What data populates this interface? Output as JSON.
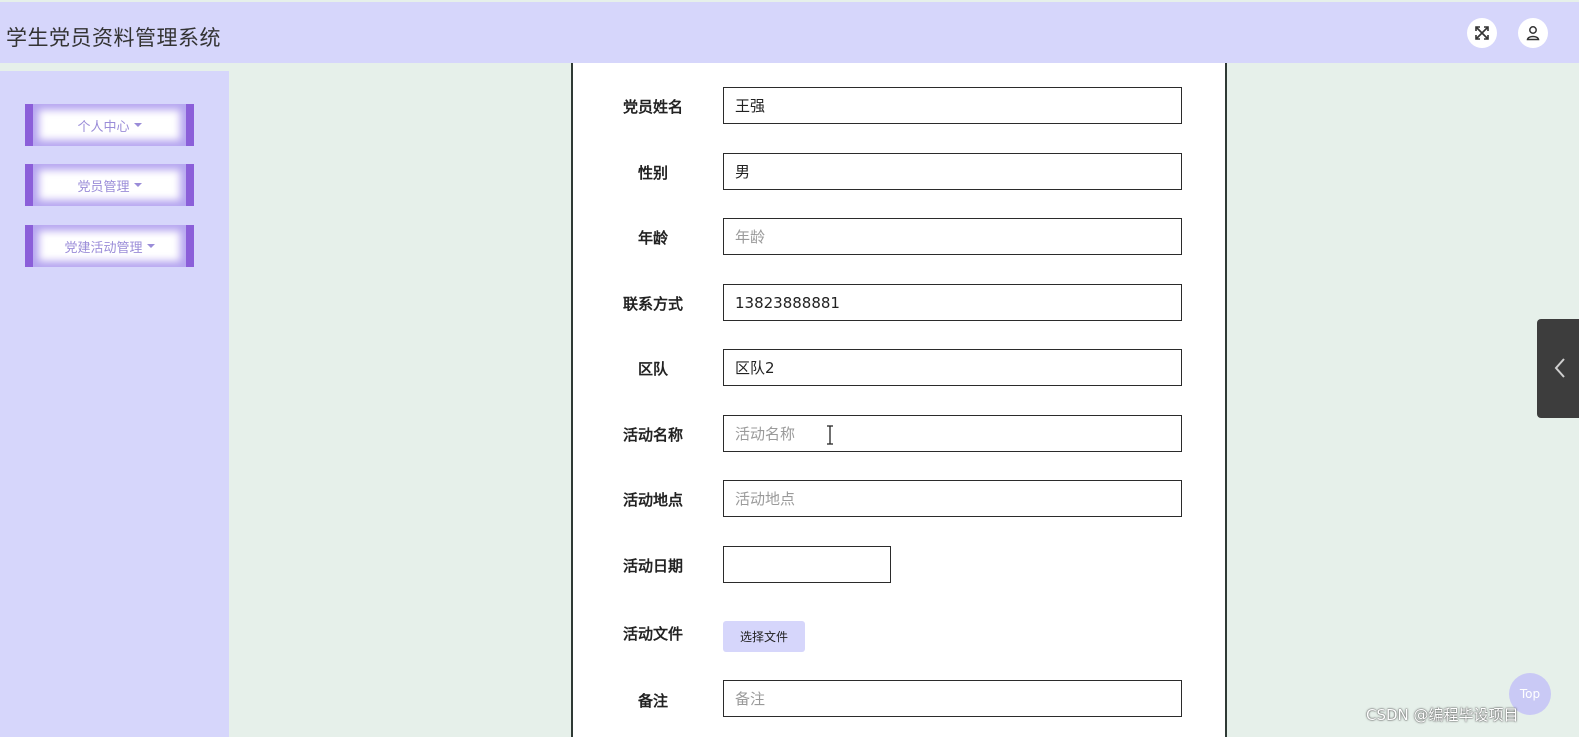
{
  "header": {
    "title": "学生党员资料管理系统",
    "fullscreen_icon": "fullscreen-icon",
    "user_icon": "user-icon"
  },
  "sidebar": {
    "items": [
      {
        "label": "个人中心"
      },
      {
        "label": "党员管理"
      },
      {
        "label": "党建活动管理"
      }
    ]
  },
  "form": {
    "party_member_name": {
      "label": "党员姓名",
      "value": "王强"
    },
    "gender": {
      "label": "性别",
      "value": "男"
    },
    "age": {
      "label": "年龄",
      "placeholder": "年龄"
    },
    "contact": {
      "label": "联系方式",
      "value": "13823888881"
    },
    "team": {
      "label": "区队",
      "value": "区队2"
    },
    "activity_name": {
      "label": "活动名称",
      "placeholder": "活动名称"
    },
    "activity_location": {
      "label": "活动地点",
      "placeholder": "活动地点"
    },
    "activity_date": {
      "label": "活动日期",
      "value": ""
    },
    "activity_file": {
      "label": "活动文件",
      "button": "选择文件"
    },
    "remark": {
      "label": "备注",
      "placeholder": "备注"
    }
  },
  "back_to_top": "Top",
  "watermark": "CSDN @编程毕设项目",
  "colors": {
    "header_bg": "#d6d6fb",
    "sidebar_accent": "#8b5fd9",
    "page_bg": "#e6f0ea"
  }
}
